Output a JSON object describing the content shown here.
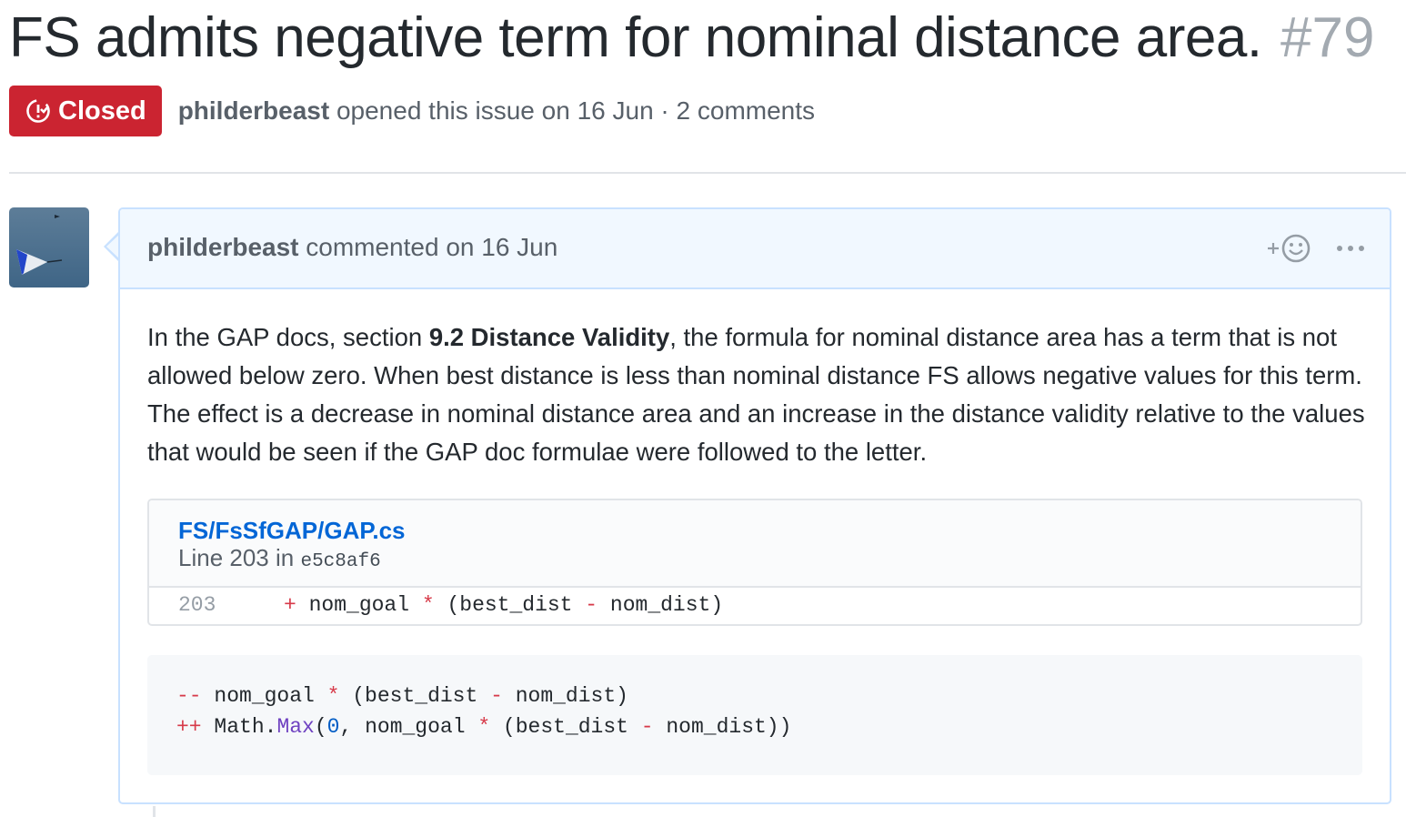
{
  "issue": {
    "title": "FS admits negative term for nominal distance area.",
    "number": "#79",
    "state": "Closed",
    "state_color": "#cb2431",
    "author": "philderbeast",
    "opened_text": "opened this issue on 16 Jun · 2 comments"
  },
  "comment": {
    "author": "philderbeast",
    "action_text": "commented on 16 Jun",
    "reaction_icon": "smiley-add-icon",
    "more_icon": "kebab-horizontal-icon",
    "border_color": "#c8e1ff",
    "header_bg": "#f1f8ff",
    "body": {
      "intro": "In the GAP docs, section ",
      "section": "9.2 Distance Validity",
      "rest": ", the formula for nominal distance area has a term that is not allowed below zero. When best distance is less than nominal distance FS allows negative values for this term. The effect is a decrease in nominal distance area and an increase in the distance validity relative to the values that would be seen if the GAP doc formulae were followed to the letter."
    },
    "snippet": {
      "path": "FS/FsSfGAP/GAP.cs",
      "line_label": "Line 203 in",
      "sha": "e5c8af6",
      "line_number": "203",
      "code": {
        "plus": "+",
        "a": " nom_goal ",
        "star": "*",
        "b": " (best_dist ",
        "minus": "-",
        "c": " nom_dist)"
      }
    },
    "codeblock": {
      "line1": {
        "marker": "--",
        "a": " nom_goal ",
        "star": "*",
        "b": " (best_dist ",
        "minus": "-",
        "c": " nom_dist)"
      },
      "line2": {
        "marker": "++",
        "a": " Math.",
        "fn": "Max",
        "b": "(",
        "num": "0",
        "c": ", nom_goal ",
        "star": "*",
        "d": " (best_dist ",
        "minus": "-",
        "e": " nom_dist))"
      }
    }
  }
}
